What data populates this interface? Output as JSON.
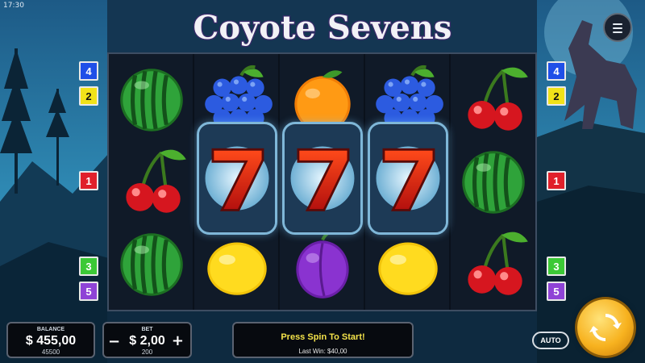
{
  "clock": "17:30",
  "game": {
    "title": "Coyote Sevens"
  },
  "paylines_left": [
    {
      "label": "4",
      "color": "#1f4fe8"
    },
    {
      "label": "2",
      "color": "#f1e219"
    },
    {
      "label": "1",
      "color": "#e0202a"
    },
    {
      "label": "3",
      "color": "#3cc936"
    },
    {
      "label": "5",
      "color": "#8f43d6"
    }
  ],
  "paylines_right": [
    {
      "label": "4",
      "color": "#1f4fe8"
    },
    {
      "label": "2",
      "color": "#f1e219"
    },
    {
      "label": "1",
      "color": "#e0202a"
    },
    {
      "label": "3",
      "color": "#3cc936"
    },
    {
      "label": "5",
      "color": "#8f43d6"
    }
  ],
  "reels": [
    [
      "watermelon",
      "cherry",
      "watermelon"
    ],
    [
      "grapes",
      "seven",
      "lemon"
    ],
    [
      "orange",
      "seven",
      "plum"
    ],
    [
      "grapes",
      "seven",
      "lemon"
    ],
    [
      "cherry",
      "watermelon",
      "cherry"
    ]
  ],
  "balance": {
    "label": "BALANCE",
    "amount": "$ 455,00",
    "credits": "45500"
  },
  "bet": {
    "label": "BET",
    "amount": "$ 2,00",
    "credits": "200",
    "minus": "−",
    "plus": "+"
  },
  "message": {
    "text": "Press Spin To Start!",
    "last_win": "Last Win: $40,00"
  },
  "controls": {
    "auto_label": "AUTO",
    "spin_icon": "spin-arrows-icon",
    "menu_icon": "hamburger-menu-icon"
  }
}
